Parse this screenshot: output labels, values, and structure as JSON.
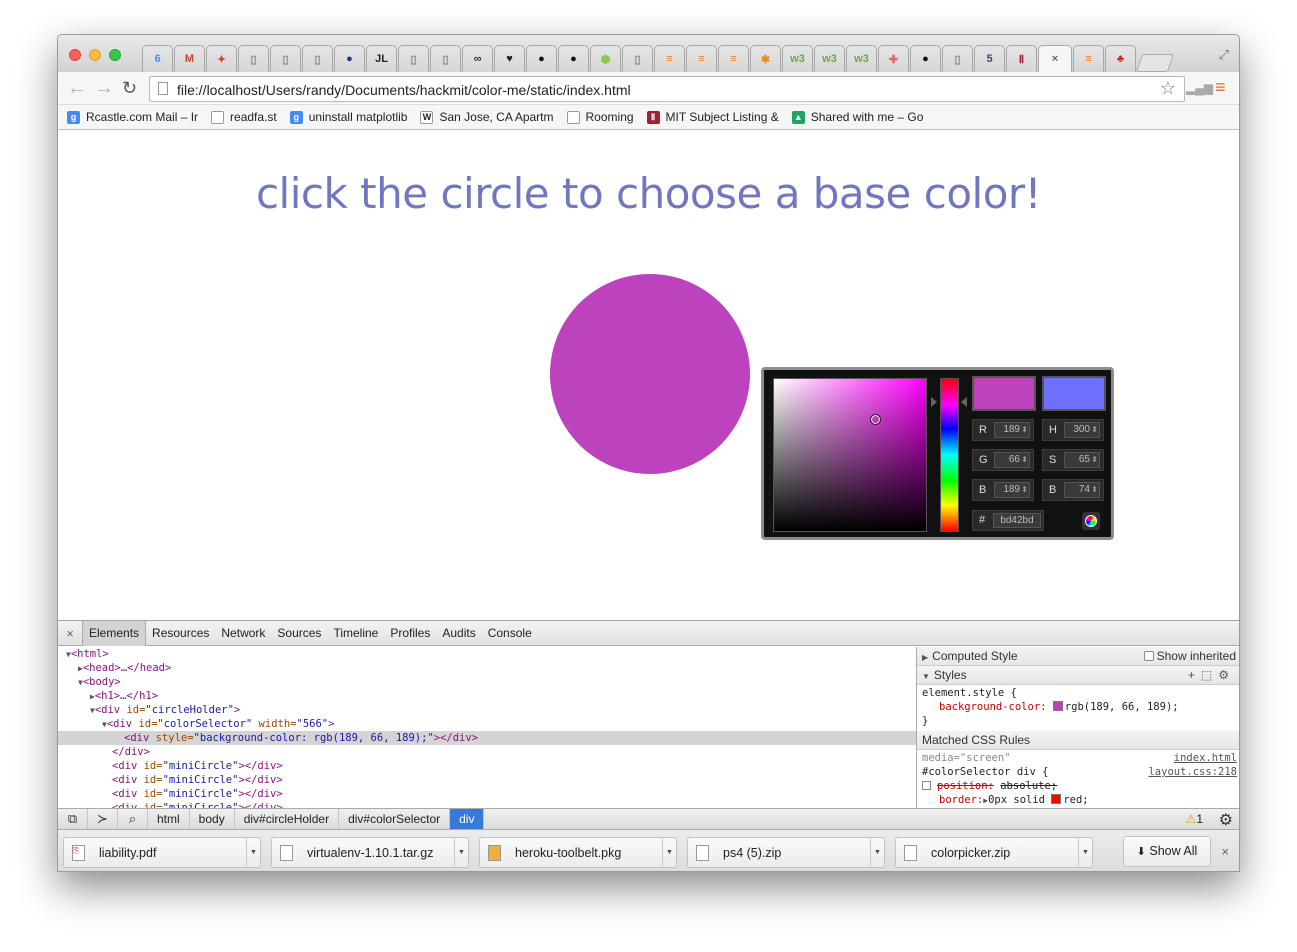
{
  "browser": {
    "url": "file://localhost/Users/randy/Documents/hackmit/color-me/static/index.html",
    "tabs": [
      {
        "label": "6",
        "color": "#4a8af4"
      },
      {
        "label": "M",
        "color": "#d0422d"
      },
      {
        "label": "✦",
        "color": "#e0402a"
      },
      {
        "label": "▯",
        "color": "#888888"
      },
      {
        "label": "▯",
        "color": "#888888"
      },
      {
        "label": "▯",
        "color": "#888888"
      },
      {
        "label": "●",
        "color": "#1d3a8a"
      },
      {
        "label": "JL",
        "color": "#222222"
      },
      {
        "label": "▯",
        "color": "#888888"
      },
      {
        "label": "▯",
        "color": "#888888"
      },
      {
        "label": "∞",
        "color": "#333333"
      },
      {
        "label": "♥",
        "color": "#222222"
      },
      {
        "label": "●",
        "color": "#111111"
      },
      {
        "label": "●",
        "color": "#111111"
      },
      {
        "label": "⬢",
        "color": "#8cc84b"
      },
      {
        "label": "▯",
        "color": "#888888"
      },
      {
        "label": "≡",
        "color": "#f48024"
      },
      {
        "label": "≡",
        "color": "#f48024"
      },
      {
        "label": "≡",
        "color": "#f48024"
      },
      {
        "label": "✱",
        "color": "#e8892b"
      },
      {
        "label": "w3",
        "color": "#6aa84f"
      },
      {
        "label": "w3",
        "color": "#6aa84f"
      },
      {
        "label": "w3",
        "color": "#6aa84f"
      },
      {
        "label": "✚",
        "color": "#e06666"
      },
      {
        "label": "●",
        "color": "#111111"
      },
      {
        "label": "▯",
        "color": "#888888"
      },
      {
        "label": "5",
        "color": "#3a4a6a"
      },
      {
        "label": "Ⅱ",
        "color": "#a31f34"
      },
      {
        "label": "×",
        "color": "#666666",
        "active": true
      },
      {
        "label": "≡",
        "color": "#f48024"
      },
      {
        "label": "♣",
        "color": "#cc2222"
      }
    ],
    "bookmarks": [
      {
        "label": "Rcastle.com Mail – Ir",
        "icon": "google-icon",
        "color": "#4a8af4",
        "glyph": "g"
      },
      {
        "label": "readfa.st",
        "icon": "page-icon",
        "color": "#ffffff",
        "glyph": ""
      },
      {
        "label": "uninstall matplotlib",
        "icon": "google-icon",
        "color": "#4a8af4",
        "glyph": "g"
      },
      {
        "label": "San Jose, CA Apartm",
        "icon": "wikipedia-icon",
        "color": "#ffffff",
        "glyph": "W"
      },
      {
        "label": "Rooming",
        "icon": "page-icon",
        "color": "#ffffff",
        "glyph": ""
      },
      {
        "label": "MIT Subject Listing &",
        "icon": "mit-icon",
        "color": "#a31f34",
        "glyph": "Ⅱ"
      },
      {
        "label": "Shared with me – Go",
        "icon": "drive-icon",
        "color": "#1fa463",
        "glyph": "▲"
      }
    ]
  },
  "page": {
    "headline": "click the circle to choose a base color!",
    "circle_color": "#bd42bd"
  },
  "picker": {
    "new_color": "#bd42bd",
    "old_color": "#6f6ffe",
    "hue_color": "#ff00ff",
    "R": "189",
    "G": "66",
    "B": "189",
    "H": "300",
    "S": "65",
    "Bv": "74",
    "hex_label": "#",
    "hex": "bd42bd",
    "labels": {
      "r": "R",
      "g": "G",
      "b": "B",
      "h": "H",
      "s": "S",
      "bv": "B"
    }
  },
  "devtools": {
    "tabs": [
      "Elements",
      "Resources",
      "Network",
      "Sources",
      "Timeline",
      "Profiles",
      "Audits",
      "Console"
    ],
    "dom": {
      "l1": "<html>",
      "l2": "<head>…</head>",
      "l3": "<body>",
      "l4": "<h1>…</h1>",
      "l5_tag": "<div ",
      "l5_attr": "id=",
      "l5_val": "\"circleHolder\"",
      "l5_end": ">",
      "l6_tag": "<div ",
      "l6_attr": "id=",
      "l6_val": "\"colorSelector\"",
      "l6_attr2": " width=",
      "l6_val2": "\"566\"",
      "l6_end": ">",
      "l7_tag": "<div ",
      "l7_attr": "style=",
      "l7_val": "\"background-color: rgb(189, 66, 189);\"",
      "l7_end": "></div>",
      "l8": "</div>",
      "mini_tag": "<div ",
      "mini_attr": "id=",
      "mini_val": "\"miniCircle\"",
      "mini_end": "></div>"
    },
    "computed_style": "Computed Style",
    "show_inherited": "Show inherited",
    "styles": "Styles",
    "element_style_open": "element.style {",
    "bg_prop": "background-color:",
    "bg_val": "rgb(189, 66, 189);",
    "close_brace": "}",
    "matched_rules": "Matched CSS Rules",
    "media": "media=\"screen\"",
    "media_src": "index.html",
    "selector": "#colorSelector div {",
    "selector_src": "layout.css:218",
    "pos_prop": "position:",
    "pos_val": "absolute;",
    "border_prop": "border:",
    "border_val": "0px solid",
    "border_color_name": "red;",
    "crumbs": [
      "html",
      "body",
      "div#circleHolder",
      "div#colorSelector",
      "div"
    ],
    "warnings": "1"
  },
  "downloads": {
    "items": [
      "liability.pdf",
      "virtualenv-1.10.1.tar.gz",
      "heroku-toolbelt.pkg",
      "ps4 (5).zip",
      "colorpicker.zip"
    ],
    "show_all": "Show All"
  }
}
